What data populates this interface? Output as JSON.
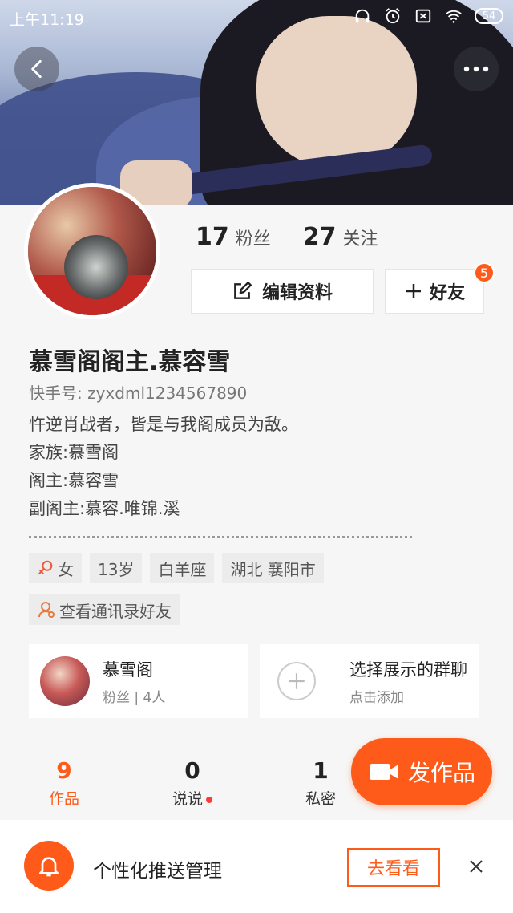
{
  "status_bar": {
    "time": "上午11:19",
    "battery": "54"
  },
  "profile": {
    "fans_count": "17",
    "fans_label": "粉丝",
    "following_count": "27",
    "following_label": "关注",
    "edit_label": "编辑资料",
    "friend_label": "好友",
    "friend_badge": "5",
    "nickname": "慕雪阁阁主.慕容雪",
    "kuaishou_id": "快手号: zyxdml1234567890",
    "bio": [
      "忤逆肖战者，皆是与我阁成员为敌。",
      "家族:慕雪阁",
      "阁主:慕容雪",
      "副阁主:慕容.唯锦.溪"
    ]
  },
  "tags": {
    "gender": "女",
    "age": "13岁",
    "zodiac": "白羊座",
    "location": "湖北 襄阳市",
    "contacts": "查看通讯录好友"
  },
  "cards": {
    "group": {
      "title": "慕雪阁",
      "sub": "粉丝 | 4人"
    },
    "add": {
      "title": "选择展示的群聊",
      "sub": "点击添加"
    }
  },
  "tabs": [
    {
      "num": "9",
      "label": "作品"
    },
    {
      "num": "0",
      "label": "说说"
    },
    {
      "num": "1",
      "label": "私密"
    }
  ],
  "publish_label": "发作品",
  "notice": {
    "text": "个性化推送管理",
    "button": "去看看"
  },
  "colors": {
    "accent": "#fe5b1a"
  }
}
